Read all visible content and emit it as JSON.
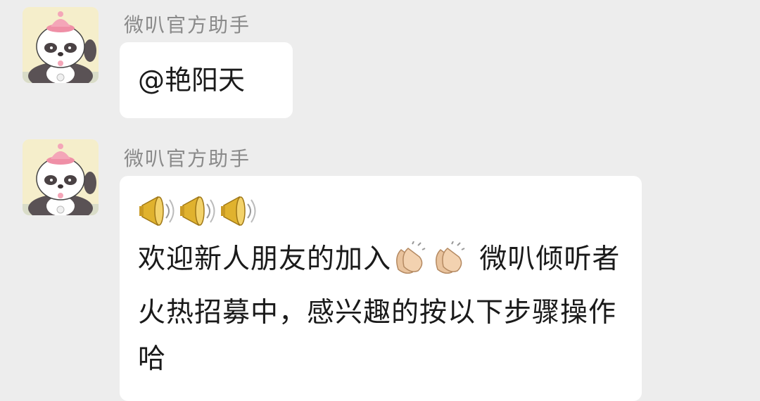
{
  "messages": [
    {
      "sender": "微叭官方助手",
      "avatar_icon": "panda-avatar-icon",
      "text": "@艳阳天"
    },
    {
      "sender": "微叭官方助手",
      "avatar_icon": "panda-avatar-icon",
      "leading_emojis": [
        "megaphone-icon",
        "megaphone-icon",
        "megaphone-icon"
      ],
      "text_part1": "欢迎新人朋友的加入",
      "inline_emojis": [
        "clapping-hands-icon",
        "clapping-hands-icon"
      ],
      "text_part2": " 微叭倾听者火热招募中，感兴趣的按以下步骤操作哈"
    }
  ],
  "colors": {
    "background": "#ededed",
    "bubble": "#ffffff",
    "sender_text": "#8a8a8a",
    "message_text": "#1a1a1a"
  }
}
